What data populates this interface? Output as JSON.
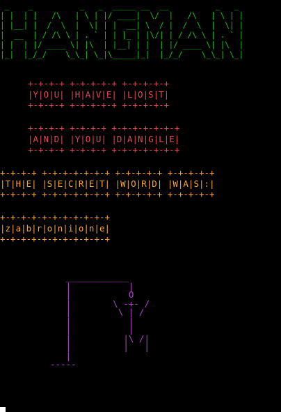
{
  "banner": {
    "lines": [
      " _    _          _   _  _____ __  __          _   _ ",
      "| |  | |   /\\   | \\ | |/ ____|  \\/  |   /\\   | \\ | |",
      "| |__| |  /  \\  |  \\| | |  __| \\  / |  /  \\  |  \\| |",
      "|  __  | / /\\ \\ | . ` | | |_ | |\\/| | / /\\ \\ | . ` |",
      "| |  | |/ ____ \\| |\\  | |__| | |  | |/ ____ \\| |\\  |",
      "|_|  |_/_/    \\_\\_| \\_|\\_____|_|  |_/_/    \\_\\_| \\_|"
    ]
  },
  "lost_message": {
    "lines": [
      "+-+-+-+ +-+-+-+-+ +-+-+-+-+",
      "|Y|O|U| |H|A|V|E| |L|O|S|T|",
      "+-+-+-+ +-+-+-+-+ +-+-+-+-+"
    ]
  },
  "dangle_message": {
    "lines": [
      "+-+-+-+ +-+-+-+ +-+-+-+-+-+-+",
      "|A|N|D| |Y|O|U| |D|A|N|G|L|E|",
      "+-+-+-+ +-+-+-+ +-+-+-+-+-+-+"
    ]
  },
  "secret_message": {
    "lines": [
      "+-+-+-+ +-+-+-+-+-+-+ +-+-+-+-+ +-+-+-+-+",
      "|T|H|E| |S|E|C|R|E|T| |W|O|R|D| |W|A|S|:|",
      "+-+-+-+ +-+-+-+-+-+-+ +-+-+-+-+ +-+-+-+-+"
    ]
  },
  "secret_word": {
    "lines": [
      "+-+-+-+-+-+-+-+-+-+-+",
      "|z|a|b|r|o|n|i|o|n|e|",
      "+-+-+-+-+-+-+-+-+-+-+"
    ]
  },
  "gallows": {
    "lines": [
      "   ____________",
      "   |           |",
      "   |           O",
      "   |        \\ -+- /",
      "   |         \\ | /",
      "   |           |",
      "   |           |",
      "   |          |\\ /|",
      "   |          |   |",
      "   |",
      "-----"
    ]
  },
  "colors": {
    "background": "#000000",
    "banner": "#16c60c",
    "lost": "#e74856",
    "secret": "#f9a825",
    "gallows": "#b148c6",
    "cursor": "#ffffff"
  }
}
